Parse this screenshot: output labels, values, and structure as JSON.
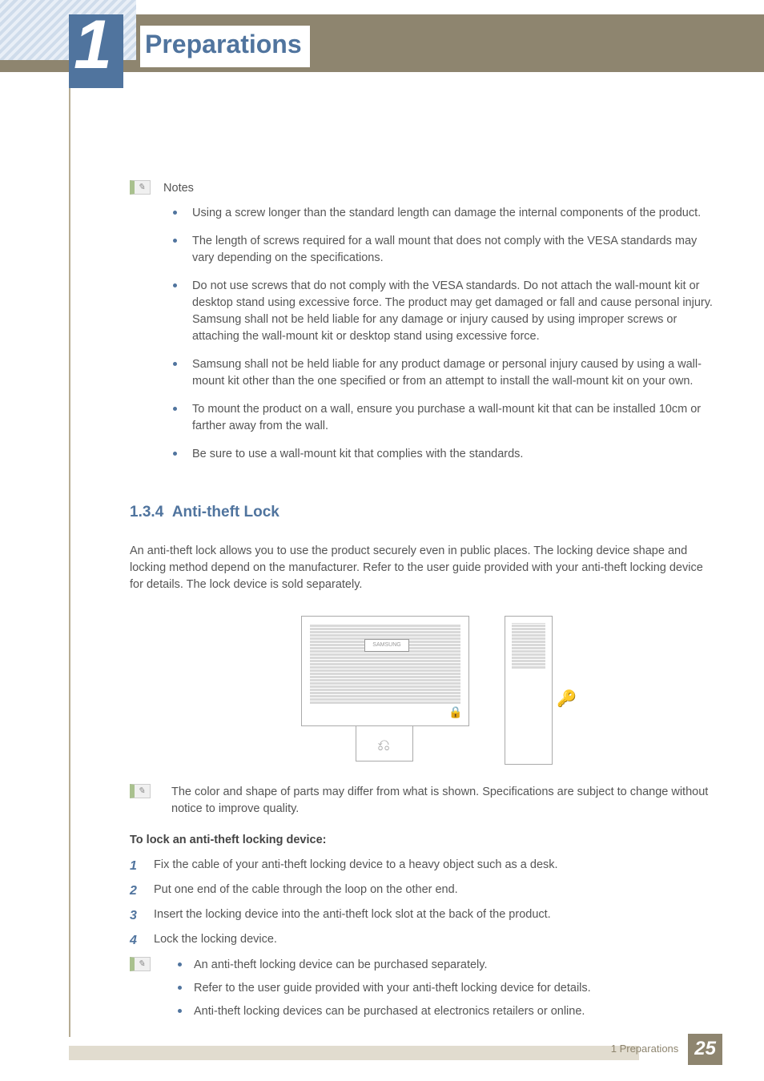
{
  "chapter": {
    "number": "1",
    "title": "Preparations"
  },
  "notes_label": "Notes",
  "notes": [
    "Using a screw longer than the standard length can damage the internal components of the product.",
    "The length of screws required for a wall mount that does not comply with the VESA standards may vary depending on the specifications.",
    "Do not use screws that do not comply with the VESA standards. Do not attach the wall-mount kit or desktop stand using excessive force. The product may get damaged or fall and cause personal injury. Samsung shall not be held liable for any damage or injury caused by using improper screws or attaching the wall-mount kit or desktop stand using excessive force.",
    "Samsung shall not be held liable for any product damage or personal injury caused by using a wall-mount kit other than the one specified or from an attempt to install the wall-mount kit on your own.",
    "To mount the product on a wall, ensure you purchase a wall-mount kit that can be installed 10cm or farther away from the wall.",
    "Be sure to use a wall-mount kit that complies with the standards."
  ],
  "section": {
    "number": "1.3.4",
    "title": "Anti-theft Lock",
    "intro": "An anti-theft lock allows you to use the product securely even in public places. The locking device shape and locking method depend on the manufacturer. Refer to the user guide provided with your anti-theft locking device for details. The lock device is sold separately.",
    "figure_note": "The color and shape of parts may differ from what is shown. Specifications are subject to change without notice to improve quality.",
    "procedure_title": "To lock an anti-theft locking device:",
    "steps": [
      "Fix the cable of your anti-theft locking device to a heavy object such as a desk.",
      "Put one end of the cable through the loop on the other end.",
      "Insert the locking device into the anti-theft lock slot at the back of the product.",
      "Lock the locking device."
    ],
    "footnotes": [
      "An anti-theft locking device can be purchased separately.",
      "Refer to the user guide provided with your anti-theft locking device for details.",
      "Anti-theft locking devices can be purchased at electronics retailers or online."
    ]
  },
  "footer": {
    "text": "1 Preparations",
    "page": "25"
  },
  "figure_brand": "SAMSUNG"
}
